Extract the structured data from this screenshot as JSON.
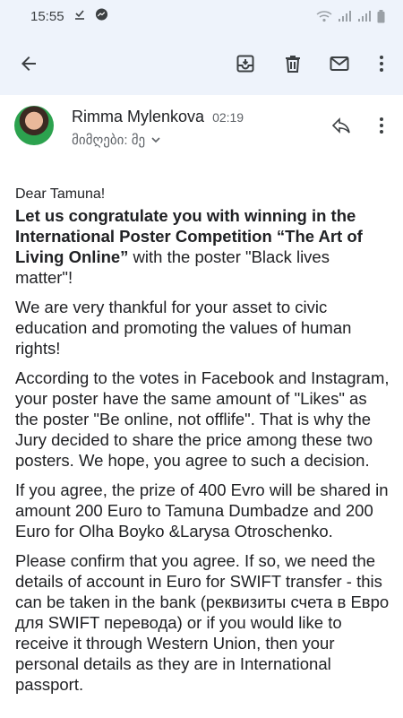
{
  "status_bar": {
    "time": "15:55"
  },
  "app_bar": {
    "icons": [
      "arrow-back-icon",
      "archive-icon",
      "delete-icon",
      "mail-icon",
      "more-vert-icon"
    ]
  },
  "sender": {
    "name": "Rimma Mylenkova",
    "time": "02:19",
    "recipient_label": "მიმღები: მე"
  },
  "body": {
    "greeting": "Dear Tamuna!",
    "p1_bold": "Let us congratulate you with winning in  the International Poster Competition “The Art of Living Online”",
    "p1_rest": " with the poster \"Black lives matter\"!",
    "p2": "We are very thankful for your asset to civic education and promoting the values of human rights!",
    "p3": "According to the votes in Facebook and Instagram, your poster have the same amount of \"Likes\" as the poster \"Be online, not offlife\". That is why the Jury decided to share the price among these two posters. We hope, you agree to such a decision.",
    "p4": "If you agree, the prize of 400 Evro will be shared in amount 200 Euro to Tamuna Dumbadze and 200 Euro for Olha Boyko &Larysa Otroschenko.",
    "p5": "Please confirm that you agree. If so, we need the details of account in Euro for SWIFT transfer - this can be taken in the bank (реквизиты счета в Евро для SWIFT перевода) or if you would like to receive it through Western Union, then your personal details as they are in International passport."
  },
  "colors": {
    "header_bg": "#eef3fb",
    "icon": "#3c4043",
    "secondary_text": "#5f6368"
  }
}
